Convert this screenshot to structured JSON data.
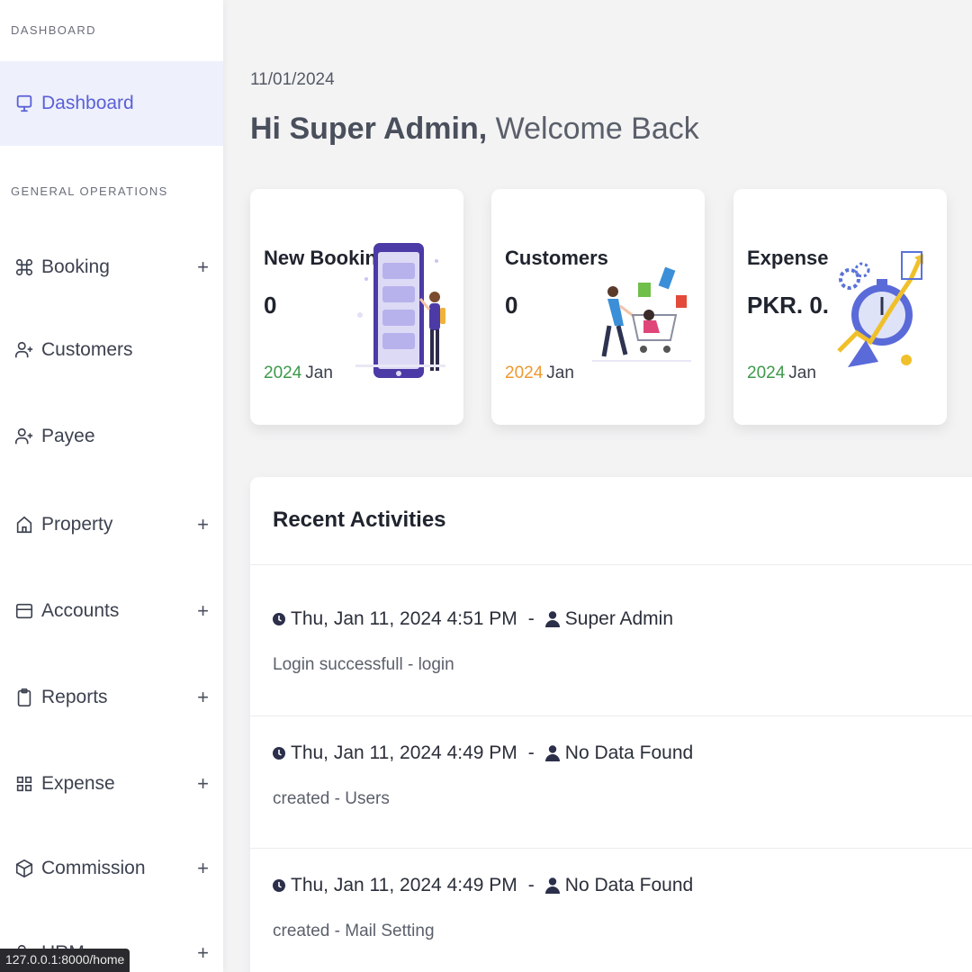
{
  "sidebar": {
    "section_dashboard": "DASHBOARD",
    "section_general": "GENERAL OPERATIONS",
    "items": [
      {
        "label": "Dashboard",
        "icon": "monitor-icon"
      },
      {
        "label": "Booking",
        "icon": "command-icon",
        "expandable": true
      },
      {
        "label": "Customers",
        "icon": "user-plus-icon"
      },
      {
        "label": "Payee",
        "icon": "user-plus-icon"
      },
      {
        "label": "Property",
        "icon": "home-icon",
        "expandable": true
      },
      {
        "label": "Accounts",
        "icon": "card-icon",
        "expandable": true
      },
      {
        "label": "Reports",
        "icon": "clipboard-icon",
        "expandable": true
      },
      {
        "label": "Expense",
        "icon": "grid-icon",
        "expandable": true
      },
      {
        "label": "Commission",
        "icon": "box-icon",
        "expandable": true
      },
      {
        "label": "HRM",
        "icon": "users-icon",
        "expandable": true
      }
    ],
    "plus": "+"
  },
  "status_url": "127.0.0.1:8000/home",
  "header": {
    "date": "11/01/2024",
    "greeting_bold": "Hi Super Admin,",
    "greeting_rest": " Welcome Back"
  },
  "cards": [
    {
      "title": "New Booking",
      "value": "0",
      "year": "2024",
      "month": "Jan",
      "year_color": "#3c9a4a"
    },
    {
      "title": "Customers",
      "value": "0",
      "year": "2024",
      "month": "Jan",
      "year_color": "#f0982f"
    },
    {
      "title": "Expense",
      "value": "PKR. 0.",
      "year": "2024",
      "month": "Jan",
      "year_color": "#3c9a4a"
    }
  ],
  "activities_panel": {
    "title": "Recent Activities",
    "items": [
      {
        "time": "Thu, Jan 11, 2024 4:51 PM",
        "sep": "-",
        "user": "Super Admin",
        "desc": "Login successfull - login"
      },
      {
        "time": "Thu, Jan 11, 2024 4:49 PM",
        "sep": "-",
        "user": "No Data Found",
        "desc": "created - Users"
      },
      {
        "time": "Thu, Jan 11, 2024 4:49 PM",
        "sep": "-",
        "user": "No Data Found",
        "desc": "created - Mail Setting"
      }
    ]
  },
  "colors": {
    "accent": "#5a60d8",
    "active_bg": "#eef0fb"
  }
}
